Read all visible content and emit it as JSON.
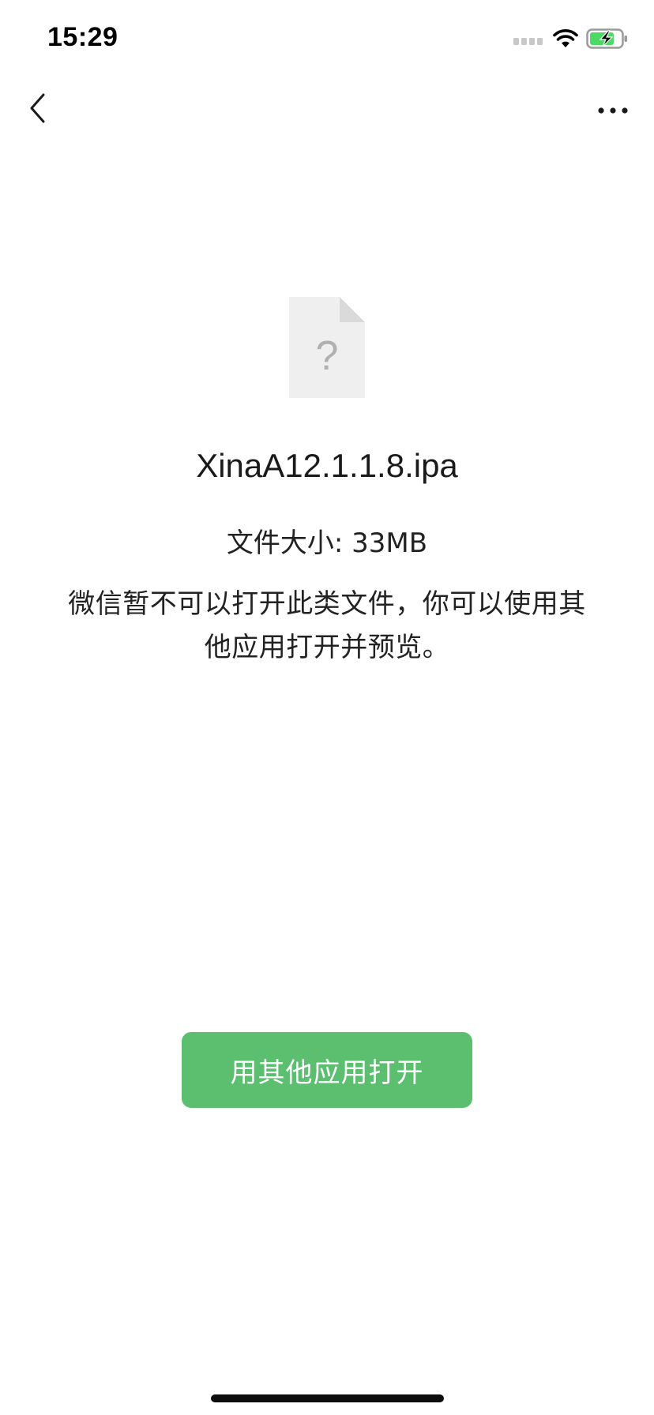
{
  "status_bar": {
    "time": "15:29",
    "icons": [
      "cellular-signal-icon",
      "wifi-icon",
      "battery-charging-icon"
    ],
    "battery_color": "#4cd964"
  },
  "nav_bar": {
    "back_icon": "chevron-left-icon",
    "more_icon": "ellipsis-icon"
  },
  "file": {
    "icon": "unknown-file-icon",
    "icon_glyph": "?",
    "name": "XinaA12.1.1.8.ipa",
    "size_label": "文件大小: 33MB"
  },
  "message": {
    "text": "微信暂不可以打开此类文件，你可以使用其他应用打开并预览。"
  },
  "actions": {
    "open_with_other_app_label": "用其他应用打开",
    "button_color": "#5bbf6f"
  }
}
